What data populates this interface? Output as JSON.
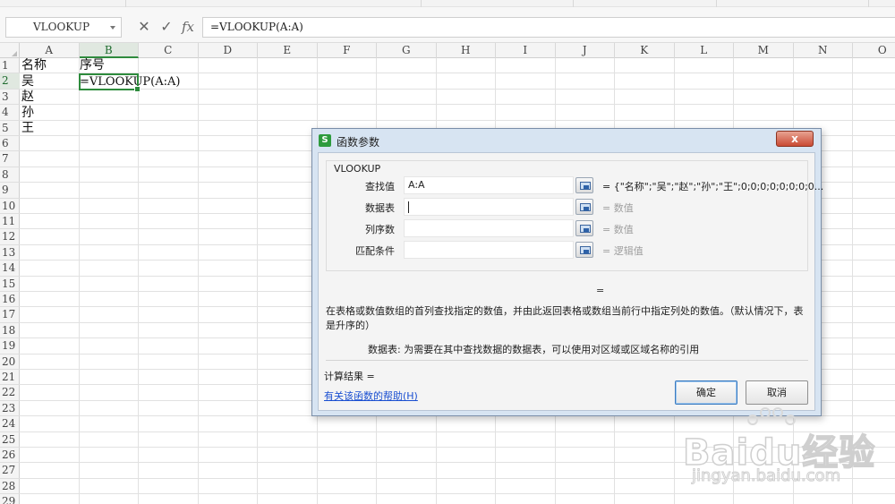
{
  "formula_bar": {
    "name_box": "VLOOKUP",
    "cancel_glyph": "✕",
    "enter_glyph": "✓",
    "fx_label": "fx",
    "formula": "=VLOOKUP(A:A)"
  },
  "columns": [
    "A",
    "B",
    "C",
    "D",
    "E",
    "F",
    "G",
    "H",
    "I",
    "J",
    "K",
    "L",
    "M",
    "N",
    "O"
  ],
  "rows": [
    "1",
    "2",
    "3",
    "4",
    "5",
    "6",
    "7",
    "8",
    "9",
    "10",
    "11",
    "12",
    "13",
    "14",
    "15",
    "16",
    "17",
    "18",
    "19",
    "20",
    "21",
    "22",
    "23",
    "24",
    "25",
    "26",
    "27",
    "28",
    "29"
  ],
  "selected": {
    "column": "B",
    "row": "2"
  },
  "cells": {
    "A1": "名称",
    "B1": "序号",
    "A2": "吴",
    "B2": "=VLOOKUP(A:A)",
    "A3": "赵",
    "A4": "孙",
    "A5": "王"
  },
  "dialog": {
    "app_icon": "S",
    "title": "函数参数",
    "close_label": "x",
    "function_name": "VLOOKUP",
    "args": [
      {
        "label": "查找值",
        "value": "A:A",
        "result": "= {\"名称\";\"吴\";\"赵\";\"孙\";\"王\";0;0;0;0;0;0;0;0...",
        "result_muted": false
      },
      {
        "label": "数据表",
        "value": "",
        "result": "= 数值",
        "result_muted": true
      },
      {
        "label": "列序数",
        "value": "",
        "result": "= 数值",
        "result_muted": true
      },
      {
        "label": "匹配条件",
        "value": "",
        "result": "= 逻辑值",
        "result_muted": true
      }
    ],
    "equals": "=",
    "description": "在表格或数值数组的首列查找指定的数值，并由此返回表格或数组当前行中指定列处的数值。（默认情况下，表是升序的）",
    "param_description": "数据表:   为需要在其中查找数据的数据表，可以使用对区域或区域名称的引用",
    "calc_result": "计算结果 =",
    "help_link": "有关该函数的帮助(H)",
    "ok_label": "确定",
    "cancel_label": "取消"
  },
  "watermark": {
    "brand": "Baidu经验",
    "url": "jingyan.baidu.com"
  },
  "colors": {
    "selection_green": "#2e8b3d",
    "dialog_frame": "#d7e4f2",
    "link_blue": "#1a4fd1",
    "close_red": "#c94a33"
  }
}
